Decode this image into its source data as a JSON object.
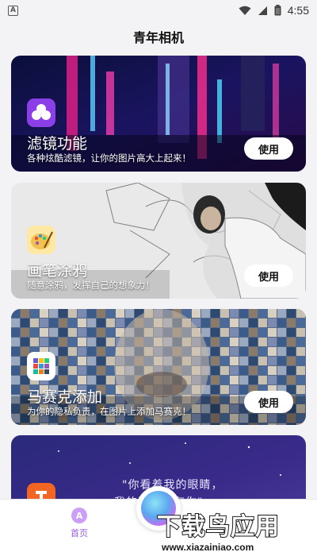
{
  "status_bar": {
    "time": "4:55",
    "notification_icon": "a-icon",
    "wifi_icon": "wifi-icon",
    "signal_icon": "signal-icon",
    "battery_icon": "battery-icon"
  },
  "app": {
    "title": "青年相机"
  },
  "features": [
    {
      "title": "滤镜功能",
      "desc": "各种炫酷滤镜，让你的图片高大上起来！",
      "button": "使用",
      "icon": "filter-circles-icon",
      "accent": "#8b3fe6"
    },
    {
      "title": "画笔涂鸦",
      "desc": "随意涂鸦，发挥自己的想象力！",
      "button": "使用",
      "icon": "paint-palette-icon",
      "accent": "#f2c14e"
    },
    {
      "title": "马赛克添加",
      "desc": "为你的隐私负责，在图片上添加马赛克！",
      "button": "使用",
      "icon": "mosaic-grid-icon",
      "accent": "#6a5acd"
    },
    {
      "title": "",
      "desc": "",
      "button": "",
      "icon": "text-t-icon",
      "accent": "#f26522",
      "quote": "\"你看着我的眼睛，",
      "quote2": "我的眼里只有你\""
    }
  ],
  "bottom_nav": {
    "home_label": "首页",
    "home_icon": "home-a-icon",
    "camera_icon": "camera-orb-icon"
  },
  "watermark": {
    "main": "下载鸟应用",
    "url": "www.xiazainiao.com"
  },
  "colors": {
    "accent_purple": "#9b5de5",
    "background": "#f3f3f5",
    "button_bg": "#ffffff"
  }
}
